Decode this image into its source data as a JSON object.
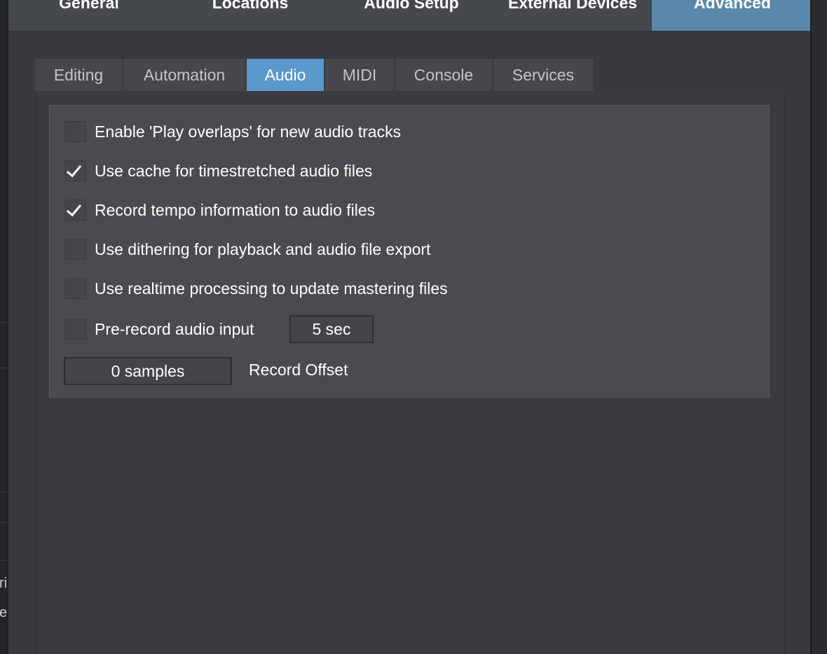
{
  "top_tabs": [
    "General",
    "Locations",
    "Audio Setup",
    "External Devices",
    "Advanced"
  ],
  "top_tabs_active": "Advanced",
  "sub_tabs": [
    "Editing",
    "Automation",
    "Audio",
    "MIDI",
    "Console",
    "Services"
  ],
  "sub_tabs_active": "Audio",
  "options": [
    {
      "label": "Enable 'Play overlaps' for new audio tracks",
      "checked": false
    },
    {
      "label": "Use cache for timestretched audio files",
      "checked": true
    },
    {
      "label": "Record tempo information to audio files",
      "checked": true
    },
    {
      "label": "Use dithering for playback and audio file export",
      "checked": false
    },
    {
      "label": "Use realtime processing to update mastering files",
      "checked": false
    },
    {
      "label": "Pre-record audio input",
      "checked": false
    }
  ],
  "pre_record_value": "5 sec",
  "record_offset": {
    "value": "0 samples",
    "label": "Record Offset"
  },
  "background_fragments": [
    "ri",
    "e"
  ],
  "colors": {
    "accent_top": "#5b87ac",
    "accent_sub": "#5b98cc",
    "panel": "#4a4b4f",
    "background": "#393a3d"
  }
}
